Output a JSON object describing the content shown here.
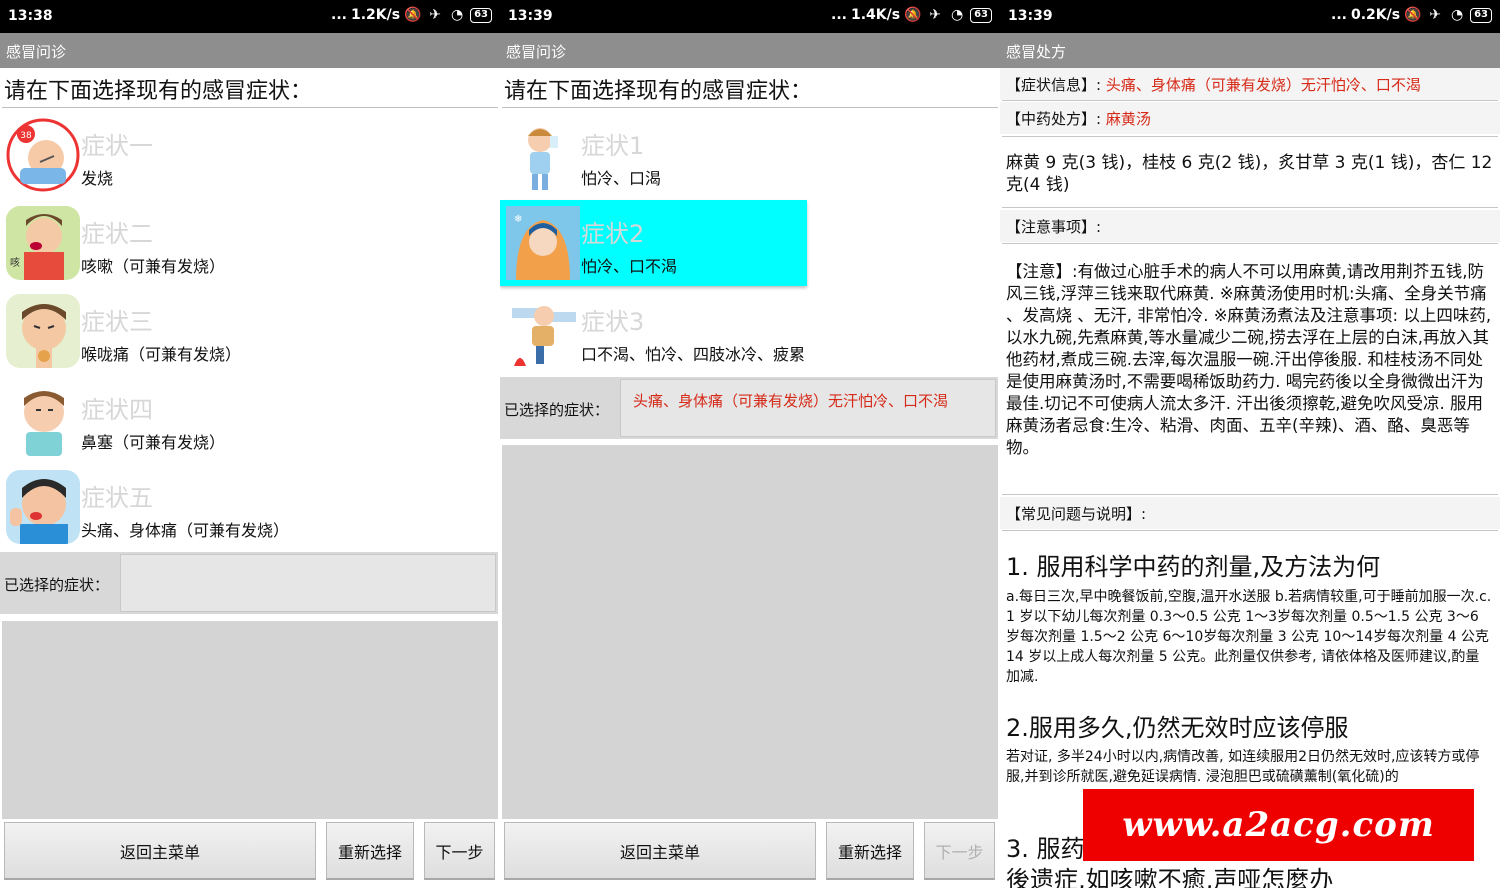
{
  "status": [
    {
      "time": "13:38",
      "speed": "1.2K/s",
      "battery": "63"
    },
    {
      "time": "13:39",
      "speed": "1.4K/s",
      "battery": "63"
    },
    {
      "time": "13:39",
      "speed": "0.2K/s",
      "battery": "63"
    }
  ],
  "status_icons": {
    "dots": "...",
    "mute": "mute-bell-icon",
    "airplane": "airplane-icon",
    "wifi": "wifi-icon"
  },
  "screen1": {
    "title": "感冒问诊",
    "prompt": "请在下面选择现有的感冒症状：",
    "items": [
      {
        "title": "症状一",
        "desc": "发烧",
        "icon": "fever-child-icon"
      },
      {
        "title": "症状二",
        "desc": "咳嗽（可兼有发烧）",
        "icon": "cough-child-icon"
      },
      {
        "title": "症状三",
        "desc": "喉咙痛（可兼有发烧）",
        "icon": "sore-throat-icon"
      },
      {
        "title": "症状四",
        "desc": "鼻塞（可兼有发烧）",
        "icon": "stuffy-nose-icon"
      },
      {
        "title": "症状五",
        "desc": "头痛、身体痛（可兼有发烧）",
        "icon": "headache-icon"
      }
    ],
    "selected_label": "已选择的症状：",
    "selected_value": "",
    "buttons": {
      "back": "返回主菜单",
      "reset": "重新选择",
      "next": "下一步"
    }
  },
  "screen2": {
    "title": "感冒问诊",
    "prompt": "请在下面选择现有的感冒症状：",
    "items": [
      {
        "title": "症状1",
        "desc": "怕冷、口渴",
        "icon": "thirsty-child-icon"
      },
      {
        "title": "症状2",
        "desc": "怕冷、口不渴",
        "icon": "cold-blanket-icon",
        "selected": true
      },
      {
        "title": "症状3",
        "desc": "口不渴、怕冷、四肢冰冷、疲累",
        "icon": "freezing-child-icon"
      }
    ],
    "selected_label": "已选择的症状：",
    "selected_value": "头痛、身体痛（可兼有发烧）无汗怕冷、口不渴",
    "buttons": {
      "back": "返回主菜单",
      "reset": "重新选择",
      "next": "下一步"
    }
  },
  "screen3": {
    "title": "感冒处方",
    "symptom_label": "【症状信息】:",
    "symptom_value": "头痛、身体痛（可兼有发烧）无汗怕冷、口不渴",
    "prescription_label": "【中药处方】:",
    "prescription_value": "麻黄汤",
    "dosage": "麻黄 9 克(3 钱)，桂枝 6 克(2 钱)，炙甘草 3 克(1 钱)，杏仁 12 克(4 钱)",
    "notes_label": "【注意事项】:",
    "notes": "【注意】:有做过心脏手术的病人不可以用麻黄,请改用荆芥五钱,防风三钱,浮萍三钱来取代麻黄. ※麻黄汤使用时机:头痛、全身关节痛 、发高烧 、无汗, 非常怕冷.   ※麻黄汤煮法及注意事项:   以上四味药,以水九碗,先煮麻黄,等水量减少二碗,捞去浮在上层的白沫,再放入其他药材,煮成三碗.去滓,每次温服一碗.汗出停後服.   和桂枝汤不同处是使用麻黄汤时,不需要喝稀饭助药力.   喝完药後以全身微微出汗为最佳.切记不可使病人流太多汗. 汗出後须擦乾,避免吹风受凉.   服用麻黄汤者忌食:生冷、粘滑、肉面、五辛(辛辣)、酒、酪、臭恶等物。",
    "faq_label": "【常见问题与说明】:",
    "faq1_title": "1. 服用科学中药的剂量,及方法为何",
    "faq1_body": "a.每日三次,早中晚餐饭前,空腹,温开水送服 b.若病情较重,可于睡前加服一次.c. 1 岁以下幼儿每次剂量 0.3～0.5 公克  1～3岁每次剂量 0.5～1.5 公克  3～6岁每次剂量 1.5～2 公克  6～10岁每次剂量 3 公克  10～14岁每次剂量 4 公克  14 岁以上成人每次剂量 5 公克。此剂量仅供参考, 请依体格及医师建议,酌量加减.",
    "faq2_title": "2.服用多久,仍然无效时应该停服",
    "faq2_body": "若对证, 多半24小时以内,病情改善, 如连续服用2日仍然无效时,应该转方或停服,并到诊所就医,避免延误病情. 浸泡胆巴或硫磺薰制(氧化硫)的",
    "faq3_title": "3. 服药",
    "faq3_cont": "後遗症,如咳嗽不癒,声哑怎麼办"
  },
  "watermark": "www.a2acg.com"
}
